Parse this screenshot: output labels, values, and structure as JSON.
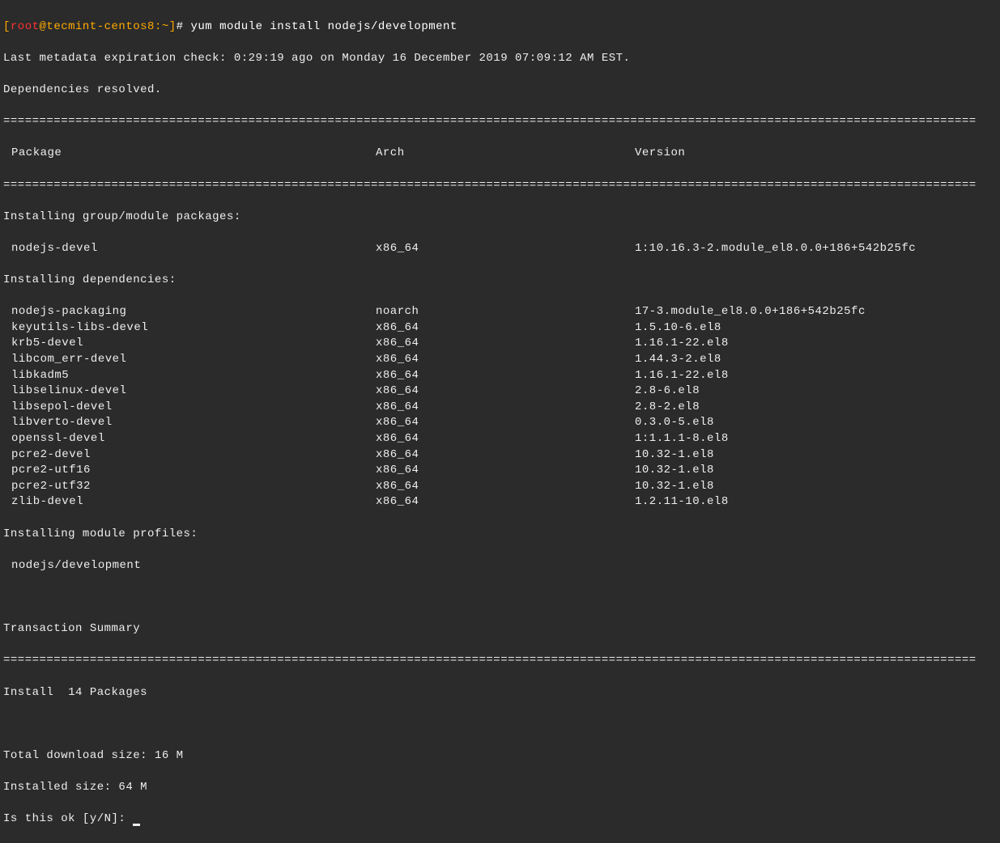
{
  "prompt": {
    "open_bracket": "[",
    "user": "root",
    "at": "@",
    "host": "tecmint-centos8",
    "path": ":~",
    "close_bracket": "]",
    "hash": "# "
  },
  "command": "yum module install nodejs/development",
  "meta_line": "Last metadata expiration check: 0:29:19 ago on Monday 16 December 2019 07:09:12 AM EST.",
  "deps_resolved": "Dependencies resolved.",
  "divider": "=======================================================================================================================================",
  "headers": {
    "package": "Package",
    "arch": "Arch",
    "version": "Version"
  },
  "sections": {
    "group_module": "Installing group/module packages:",
    "dependencies": "Installing dependencies:",
    "module_profiles": "Installing module profiles:"
  },
  "group_packages": [
    {
      "name": "nodejs-devel",
      "arch": "x86_64",
      "version": "1:10.16.3-2.module_el8.0.0+186+542b25fc"
    }
  ],
  "dep_packages": [
    {
      "name": "nodejs-packaging",
      "arch": "noarch",
      "version": "17-3.module_el8.0.0+186+542b25fc"
    },
    {
      "name": "keyutils-libs-devel",
      "arch": "x86_64",
      "version": "1.5.10-6.el8"
    },
    {
      "name": "krb5-devel",
      "arch": "x86_64",
      "version": "1.16.1-22.el8"
    },
    {
      "name": "libcom_err-devel",
      "arch": "x86_64",
      "version": "1.44.3-2.el8"
    },
    {
      "name": "libkadm5",
      "arch": "x86_64",
      "version": "1.16.1-22.el8"
    },
    {
      "name": "libselinux-devel",
      "arch": "x86_64",
      "version": "2.8-6.el8"
    },
    {
      "name": "libsepol-devel",
      "arch": "x86_64",
      "version": "2.8-2.el8"
    },
    {
      "name": "libverto-devel",
      "arch": "x86_64",
      "version": "0.3.0-5.el8"
    },
    {
      "name": "openssl-devel",
      "arch": "x86_64",
      "version": "1:1.1.1-8.el8"
    },
    {
      "name": "pcre2-devel",
      "arch": "x86_64",
      "version": "10.32-1.el8"
    },
    {
      "name": "pcre2-utf16",
      "arch": "x86_64",
      "version": "10.32-1.el8"
    },
    {
      "name": "pcre2-utf32",
      "arch": "x86_64",
      "version": "10.32-1.el8"
    },
    {
      "name": "zlib-devel",
      "arch": "x86_64",
      "version": "1.2.11-10.el8"
    }
  ],
  "module_profile": "nodejs/development",
  "transaction_summary": "Transaction Summary",
  "install_summary": "Install  14 Packages",
  "download_size": "Total download size: 16 M",
  "installed_size": "Installed size: 64 M",
  "confirm_prompt": "Is this ok [y/N]: "
}
